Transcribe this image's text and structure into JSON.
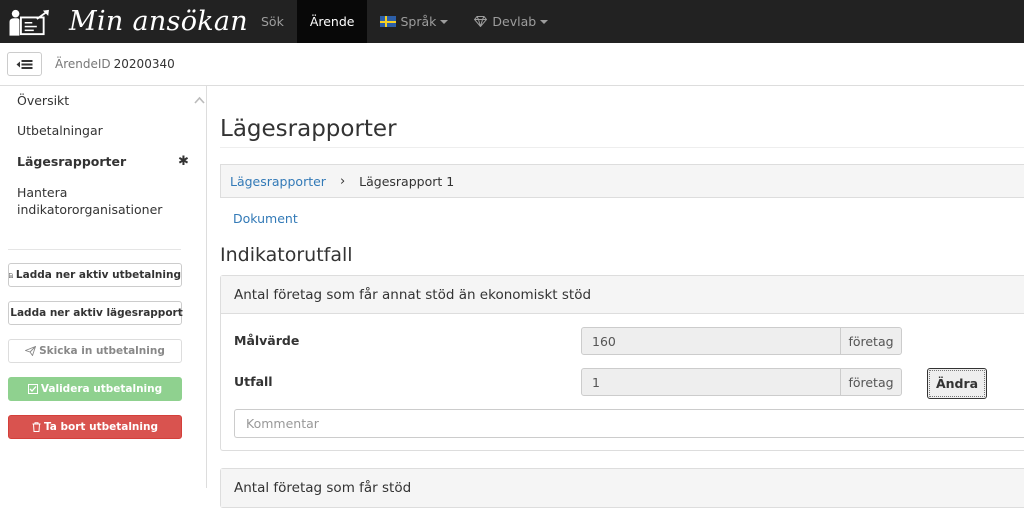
{
  "navbar": {
    "brand_title": "Min ansökan",
    "items": [
      {
        "label": "Sök"
      },
      {
        "label": "Ärende"
      },
      {
        "label": "Språk"
      },
      {
        "label": "Devlab"
      }
    ]
  },
  "subheader": {
    "case_label": "ÄrendeID",
    "case_id": "20200340"
  },
  "sidebar": {
    "menu": [
      {
        "label": "Översikt"
      },
      {
        "label": "Utbetalningar"
      },
      {
        "label": "Lägesrapporter"
      },
      {
        "label": "Hantera indikatororganisationer"
      }
    ],
    "buttons": [
      {
        "label": "Ladda ner aktiv utbetalning"
      },
      {
        "label": "Ladda ner aktiv lägesrapport"
      },
      {
        "label": "Skicka in utbetalning"
      },
      {
        "label": "Validera utbetalning"
      },
      {
        "label": "Ta bort utbetalning"
      }
    ]
  },
  "main": {
    "title": "Lägesrapporter",
    "breadcrumb": [
      {
        "label": "Lägesrapporter"
      },
      {
        "label": "Lägesrapport 1"
      }
    ],
    "document_link": "Dokument",
    "section_title": "Indikatorutfall",
    "panels": [
      {
        "heading": "Antal företag som får annat stöd än ekonomiskt stöd",
        "target_label": "Målvärde",
        "target_value": "160",
        "target_unit": "företag",
        "outcome_label": "Utfall",
        "outcome_value": "1",
        "outcome_unit": "företag",
        "edit_button": "Ändra",
        "comment_placeholder": "Kommentar"
      },
      {
        "heading": "Antal företag som får stöd"
      }
    ]
  },
  "colors": {
    "navbar_bg": "#222222",
    "link": "#337ab7",
    "validate_green": "#8fd18f",
    "delete_red": "#d9534f"
  }
}
